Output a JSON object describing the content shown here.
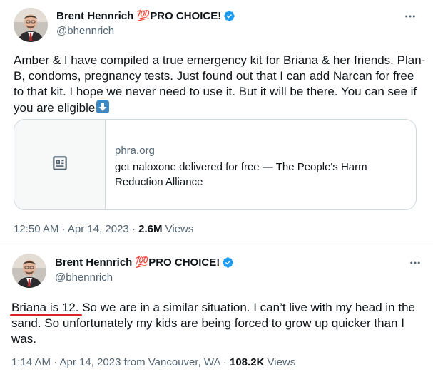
{
  "tweets": [
    {
      "display_name": "Brent Hennrich 💯PRO CHOICE!",
      "handle": "@bhennrich",
      "text": "Amber & I have compiled a true emergency kit for Briana & her friends. Plan-B, condoms, pregnancy tests. Just found out that I can add Narcan for free to that kit. I hope we never need to use it. But it will be there. You can see if you are eligible",
      "text_emoji": "down-arrow-emoji",
      "card": {
        "domain": "phra.org",
        "title": "get naloxone delivered for free — The People's Harm Reduction Alliance",
        "thumb_icon": "article-icon"
      },
      "timestamp": "12:50 AM · Apr 14, 2023",
      "separator": " · ",
      "views_count": "2.6M",
      "views_label": " Views"
    },
    {
      "display_name": "Brent Hennrich 💯PRO CHOICE!",
      "handle": "@bhennrich",
      "text_highlight": "Briana is 12.",
      "text_rest": " So we are in a similar situation. I can’t live with my head in the sand. So unfortunately my kids are being forced to grow up quicker than I was.",
      "timestamp": "1:14 AM · Apr 14, 2023 from Vancouver, WA",
      "separator": " · ",
      "views_count": "108.2K",
      "views_label": " Views"
    }
  ],
  "colors": {
    "verified": "#1d9bf0",
    "secondary_text": "#536471",
    "highlight_underline": "#d9242c"
  }
}
